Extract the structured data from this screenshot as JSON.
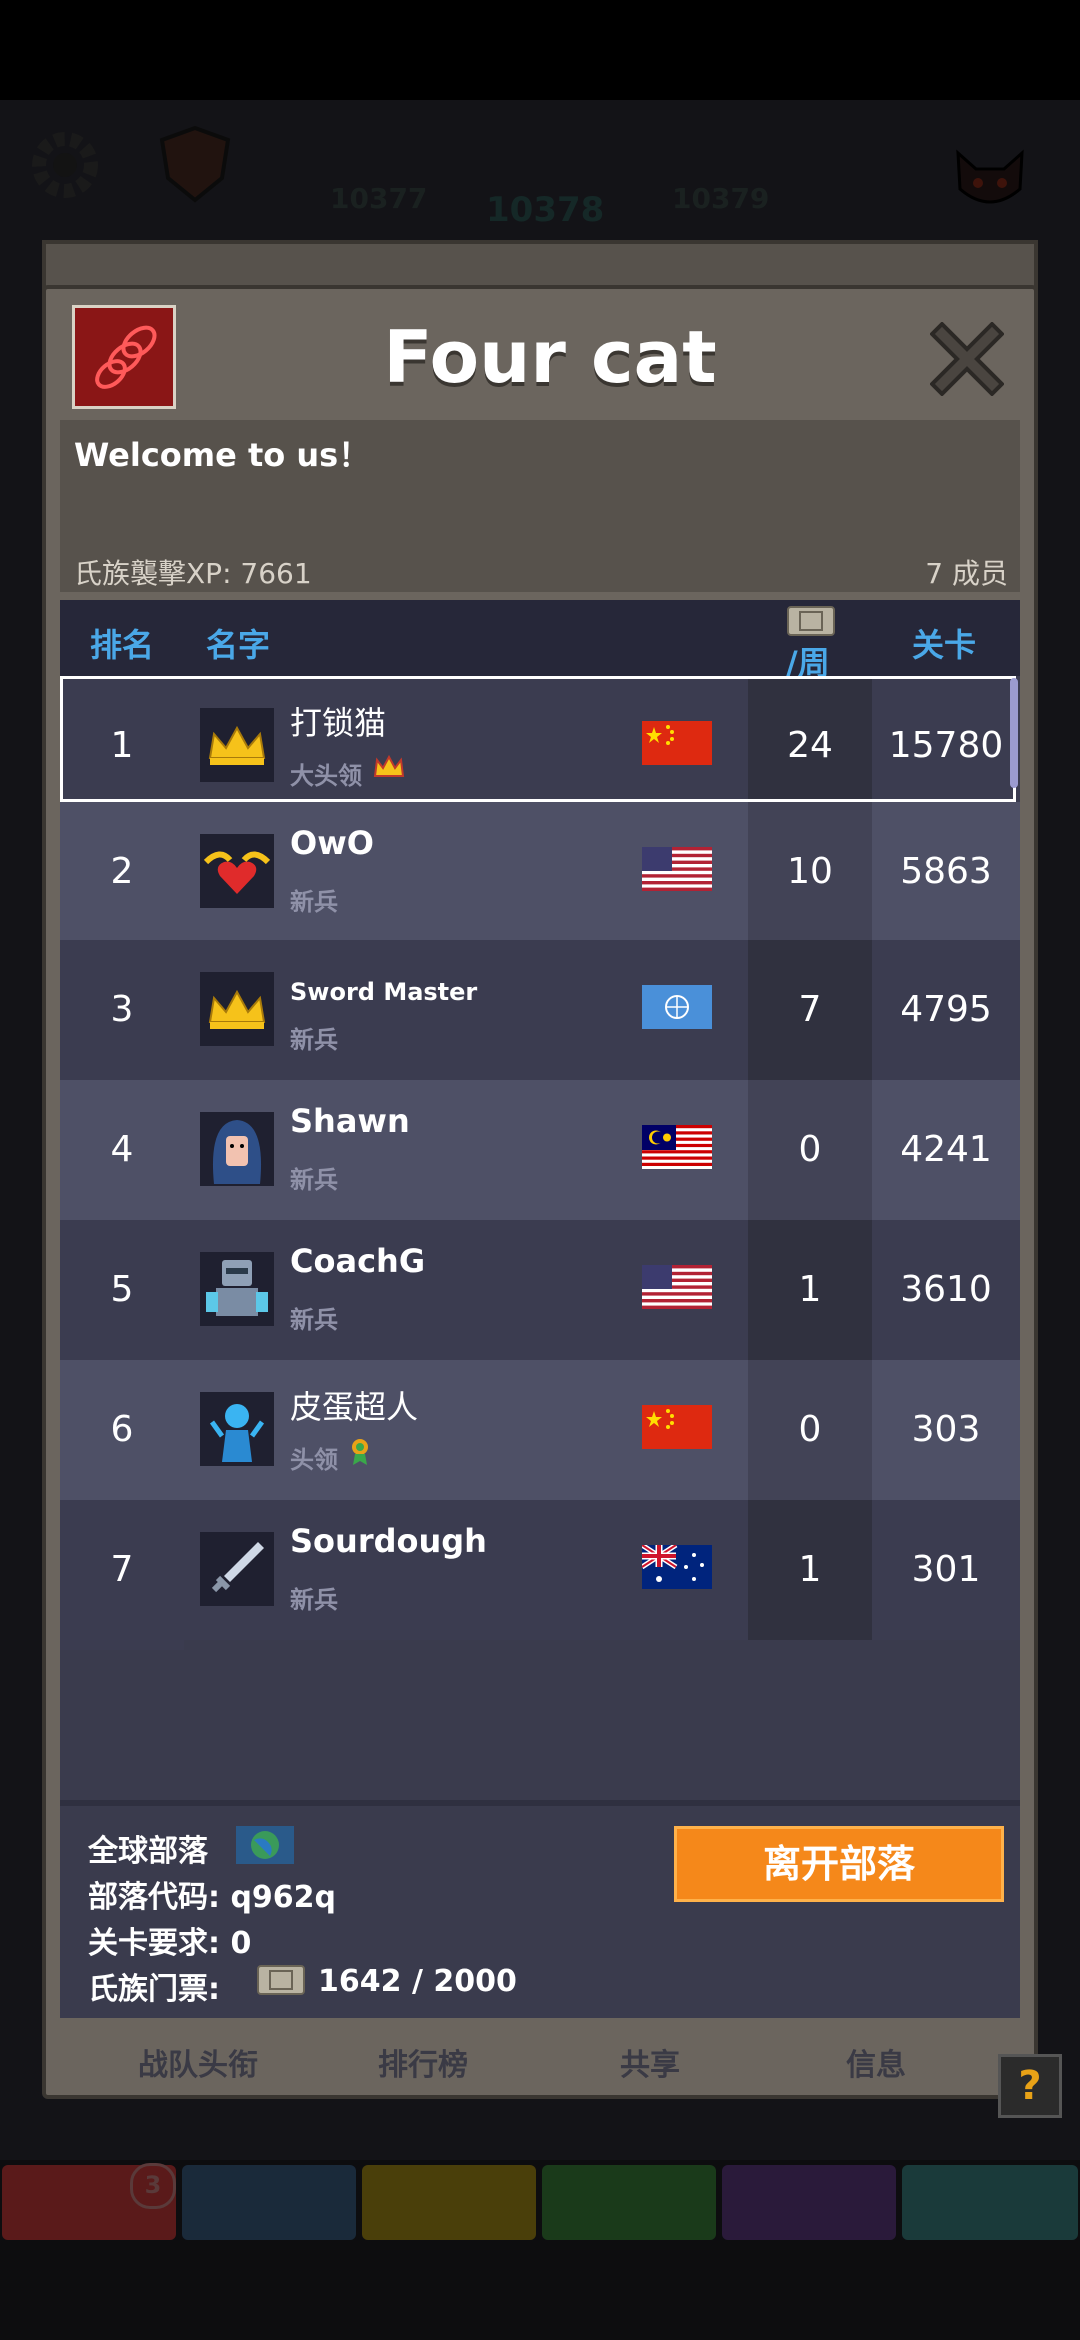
{
  "hud": {
    "stages": [
      "10377",
      "10378",
      "10379"
    ],
    "tab_badge": "3"
  },
  "clan": {
    "title": "Four cat",
    "description": "Welcome to us！",
    "xp_label": "氏族襲擊XP: 7661",
    "members_label": "7 成员"
  },
  "table": {
    "headers": {
      "rank": "排名",
      "name": "名字",
      "week": "/周",
      "level": "关卡"
    },
    "rows": [
      {
        "rank": "1",
        "name": "打锁猫",
        "role": "大头领",
        "flag": "china",
        "week": "24",
        "level": "15780"
      },
      {
        "rank": "2",
        "name": "OwO",
        "role": "新兵",
        "flag": "usa",
        "week": "10",
        "level": "5863"
      },
      {
        "rank": "3",
        "name": "Sword Master",
        "role": "新兵",
        "flag": "globe",
        "week": "7",
        "level": "4795"
      },
      {
        "rank": "4",
        "name": "Shawn",
        "role": "新兵",
        "flag": "malaysia",
        "week": "0",
        "level": "4241"
      },
      {
        "rank": "5",
        "name": "CoachG",
        "role": "新兵",
        "flag": "usa",
        "week": "1",
        "level": "3610"
      },
      {
        "rank": "6",
        "name": "皮蛋超人",
        "role": "头领",
        "flag": "china",
        "week": "0",
        "level": "303"
      },
      {
        "rank": "7",
        "name": "Sourdough",
        "role": "新兵",
        "flag": "australia",
        "week": "1",
        "level": "301"
      }
    ]
  },
  "footer": {
    "global_clan": "全球部落",
    "clan_code": "部落代码: q962q",
    "level_req": "关卡要求:  0",
    "ticket_label": "氏族门票:",
    "ticket_value": "1642 / 2000",
    "leave_button": "离开部落"
  },
  "bottom_tabs": [
    "战队头衔",
    "排行榜",
    "共享",
    "信息"
  ],
  "help_label": "?"
}
